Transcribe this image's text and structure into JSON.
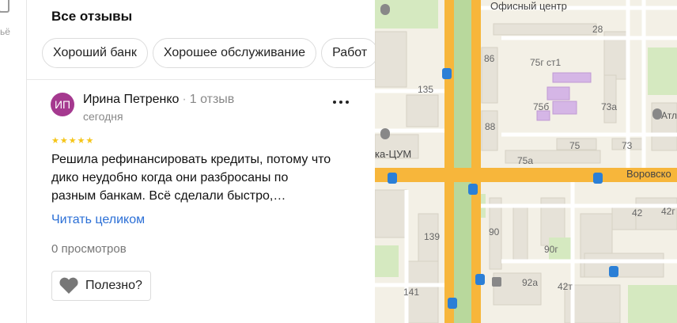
{
  "left_strip": {
    "label": "ьё"
  },
  "panel": {
    "title": "Все отзывы",
    "chips": [
      "Хороший банк",
      "Хорошее обслуживание",
      "Работ"
    ]
  },
  "review": {
    "avatar_initials": "ИП",
    "author": "Ирина Петренко",
    "separator": "·",
    "review_count": "1 отзыв",
    "date": "сегодня",
    "rating": 5,
    "stars": [
      "★",
      "★",
      "★",
      "★",
      "★"
    ],
    "text_lines": [
      "Решила рефинансировать кредиты, потому что",
      "дико неудобно когда они разбросаны по",
      "разным банкам. Всё сделали быстро,…"
    ],
    "read_more": "Читать целиком",
    "views": "0 просмотров",
    "useful_label": "Полезно?"
  },
  "map": {
    "labels": {
      "office_center": "Офисный центр",
      "vorovskogo": "Воровско",
      "tsum": "ка-ЦУМ",
      "atl": "Атл",
      "n28": "28",
      "n86": "86",
      "n75_st1": "75г ст1",
      "n135": "135",
      "n75b": "75б",
      "n73a": "73а",
      "n88": "88",
      "n75": "75",
      "n73": "73",
      "n75a": "75а",
      "n42": "42",
      "n42r": "42г",
      "n139": "139",
      "n90": "90",
      "n90g": "90г",
      "n92a": "92а",
      "n42t": "42т",
      "n141": "141"
    },
    "colors": {
      "major_road": "#f7b63b",
      "minor_road": "#ffffff",
      "park": "#d5e9c0",
      "building": "#e6e2d8",
      "highlight_building": "#d5b6e6",
      "transit_icon": "#2b7fd6"
    }
  }
}
